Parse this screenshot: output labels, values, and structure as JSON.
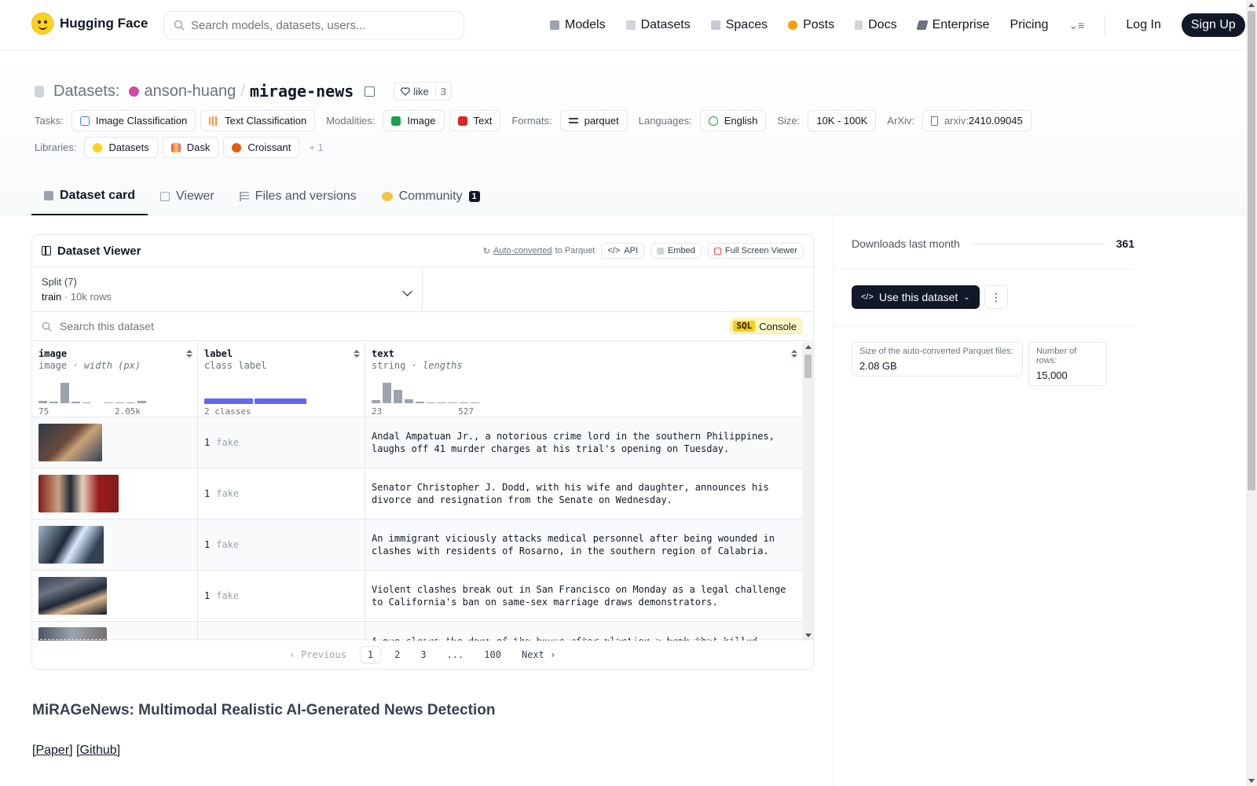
{
  "header": {
    "brand": "Hugging Face",
    "search_placeholder": "Search models, datasets, users...",
    "nav": [
      {
        "label": "Models",
        "icon": "cube-icon",
        "color": "#9ca3af"
      },
      {
        "label": "Datasets",
        "icon": "database-icon",
        "color": "#9ca3af"
      },
      {
        "label": "Spaces",
        "icon": "grid-icon",
        "color": "#9ca3af"
      },
      {
        "label": "Posts",
        "icon": "posts-icon",
        "color": "#f59e0b"
      },
      {
        "label": "Docs",
        "icon": "docs-icon",
        "color": "#9ca3af"
      },
      {
        "label": "Enterprise",
        "icon": "enterprise-icon",
        "color": "#6b7280"
      },
      {
        "label": "Pricing"
      }
    ],
    "login": "Log In",
    "signup": "Sign Up"
  },
  "title": {
    "prefix": "Datasets:",
    "user": "anson-huang",
    "slash": "/",
    "name": "mirage-news",
    "like_label": "like",
    "like_count": "3"
  },
  "tags": {
    "tasks_label": "Tasks:",
    "tasks": [
      "Image Classification",
      "Text Classification"
    ],
    "modalities_label": "Modalities:",
    "modalities": [
      "Image",
      "Text"
    ],
    "formats_label": "Formats:",
    "formats": [
      "parquet"
    ],
    "languages_label": "Languages:",
    "languages": [
      "English"
    ],
    "size_label": "Size:",
    "size": "10K - 100K",
    "arxiv_label": "ArXiv:",
    "arxiv_prefix": "arxiv:",
    "arxiv_id": "2410.09045",
    "libraries_label": "Libraries:",
    "libraries": [
      "Datasets",
      "Dask",
      "Croissant"
    ],
    "libraries_more": "+ 1"
  },
  "tabs": [
    {
      "label": "Dataset card",
      "active": true
    },
    {
      "label": "Viewer"
    },
    {
      "label": "Files and versions"
    },
    {
      "label": "Community",
      "badge": "1"
    }
  ],
  "viewer": {
    "title": "Dataset Viewer",
    "auto_converted": "Auto-converted",
    "to_parquet": "to Parquet",
    "api": "API",
    "embed": "Embed",
    "full_screen": "Full Screen Viewer",
    "split_label": "Split (7)",
    "split_value": "train",
    "split_rows": "10k rows",
    "search_placeholder": "Search this dataset",
    "sql": "SQL",
    "console": "Console",
    "columns": [
      {
        "name": "image",
        "type": "image",
        "stat": "width (px)",
        "min": "75",
        "max": "2.05k"
      },
      {
        "name": "label",
        "type": "class label",
        "stat": "",
        "summary": "2 classes"
      },
      {
        "name": "text",
        "type": "string",
        "stat": "lengths",
        "min": "23",
        "max": "527"
      }
    ],
    "rows": [
      {
        "label_num": "1",
        "label_name": "fake",
        "text": "Andal Ampatuan Jr., a notorious crime lord in the southern Philippines, laughs off 41 murder charges at his trial's opening on Tuesday."
      },
      {
        "label_num": "1",
        "label_name": "fake",
        "text": "Senator Christopher J. Dodd, with his wife and daughter, announces his divorce and resignation from the Senate on Wednesday."
      },
      {
        "label_num": "1",
        "label_name": "fake",
        "text": "An immigrant viciously attacks medical personnel after being wounded in clashes with residents of Rosarno, in the southern region of Calabria."
      },
      {
        "label_num": "1",
        "label_name": "fake",
        "text": "Violent clashes break out in San Francisco on Monday as a legal challenge to California's ban on same-sex marriage draws demonstrators."
      },
      {
        "label_num": "",
        "label_name": "",
        "text": "A man closes the door of the house after planting a bomb that killed Iranian"
      }
    ],
    "pager": {
      "previous": "Previous",
      "pages": [
        "1",
        "2",
        "3",
        "...",
        "100"
      ],
      "next": "Next"
    }
  },
  "sidebar": {
    "downloads_label": "Downloads last month",
    "downloads": "361",
    "use_dataset": "Use this dataset",
    "parquet_size_label": "Size of the auto-converted Parquet files:",
    "parquet_size": "2.08 GB",
    "rows_label": "Number of rows:",
    "rows": "15,000"
  },
  "card": {
    "heading": "MiRAGeNews: Multimodal Realistic AI-Generated News Detection",
    "paper_link": "[Paper]",
    "github_link": "[Github]"
  }
}
